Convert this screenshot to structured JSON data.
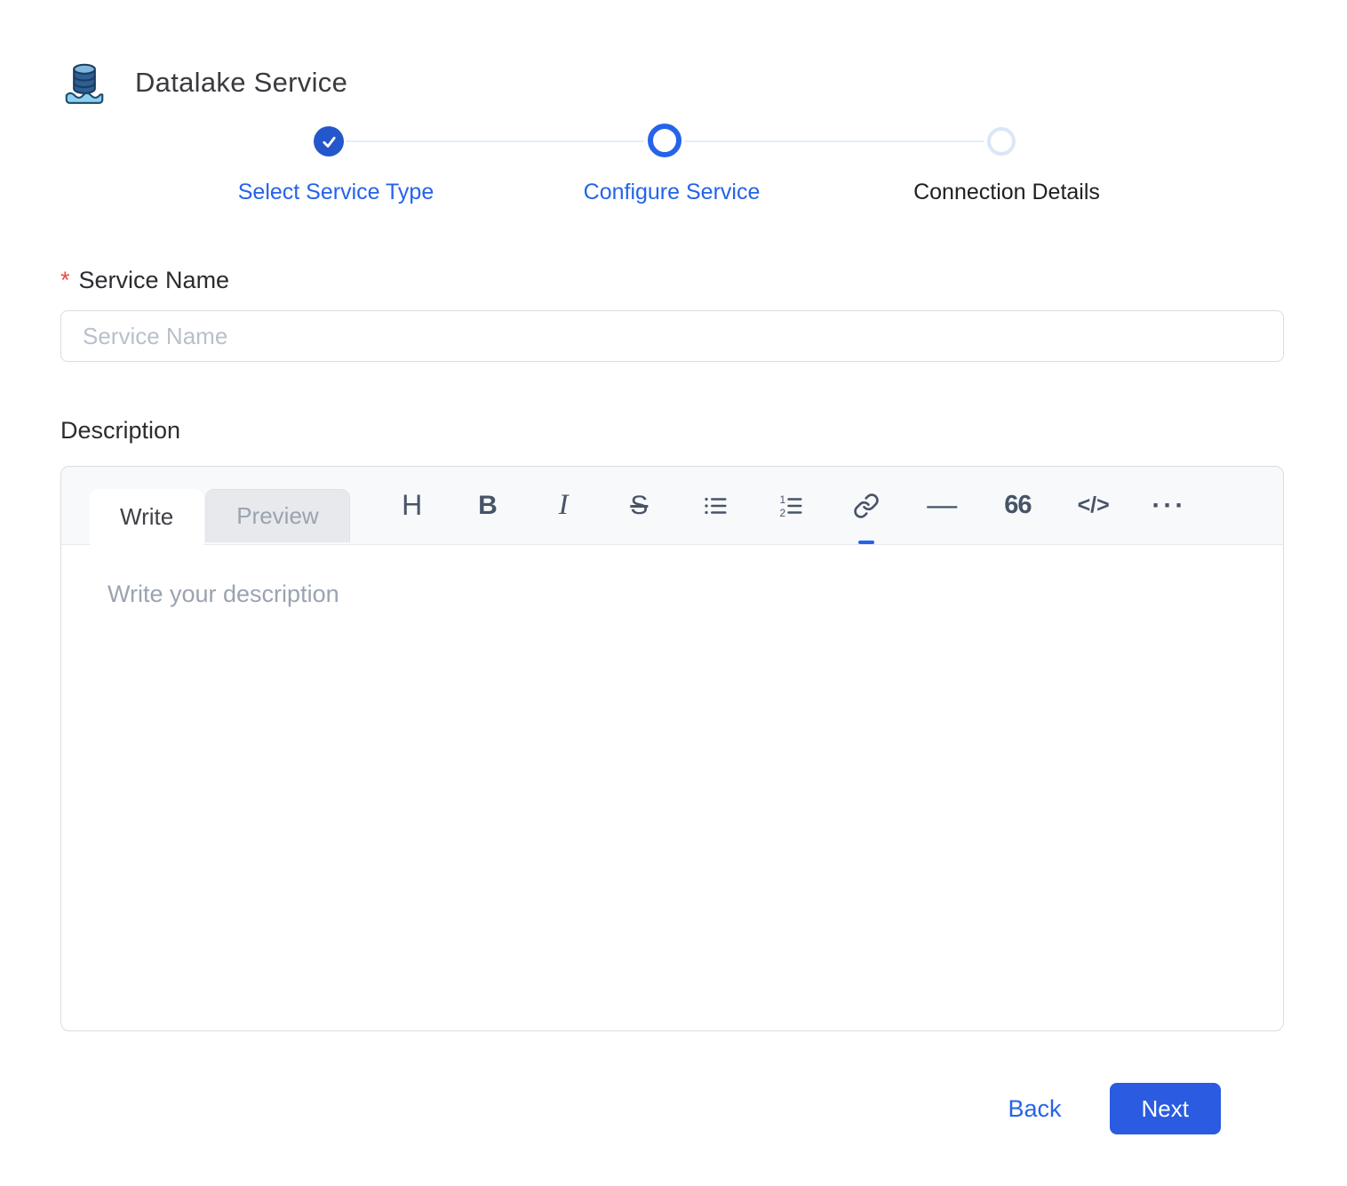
{
  "header": {
    "title": "Datalake Service"
  },
  "stepper": {
    "steps": [
      {
        "label": "Select Service Type",
        "state": "completed"
      },
      {
        "label": "Configure Service",
        "state": "active"
      },
      {
        "label": "Connection Details",
        "state": "pending"
      }
    ]
  },
  "form": {
    "required_marker": "*",
    "service_name_label": "Service Name",
    "service_name_placeholder": "Service Name",
    "service_name_value": "",
    "description_label": "Description"
  },
  "editor": {
    "tabs": [
      {
        "label": "Write",
        "state": "active"
      },
      {
        "label": "Preview",
        "state": "inactive"
      }
    ],
    "toolbar": [
      {
        "name": "heading",
        "glyph": "H"
      },
      {
        "name": "bold",
        "glyph": "B"
      },
      {
        "name": "italic",
        "glyph": "I"
      },
      {
        "name": "strikethrough",
        "glyph": "S"
      },
      {
        "name": "bullet-list",
        "glyph": ""
      },
      {
        "name": "numbered-list",
        "glyph": ""
      },
      {
        "name": "link",
        "glyph": ""
      },
      {
        "name": "horizontal-rule",
        "glyph": "—"
      },
      {
        "name": "quote",
        "glyph": "66"
      },
      {
        "name": "code",
        "glyph": "</>"
      },
      {
        "name": "more",
        "glyph": "···"
      }
    ],
    "placeholder": "Write your description",
    "value": ""
  },
  "footer": {
    "back_label": "Back",
    "next_label": "Next"
  },
  "colors": {
    "accent": "#2563eb",
    "completed_step": "#2457cc",
    "next_button": "#2a5be0",
    "required": "#f0483e"
  }
}
